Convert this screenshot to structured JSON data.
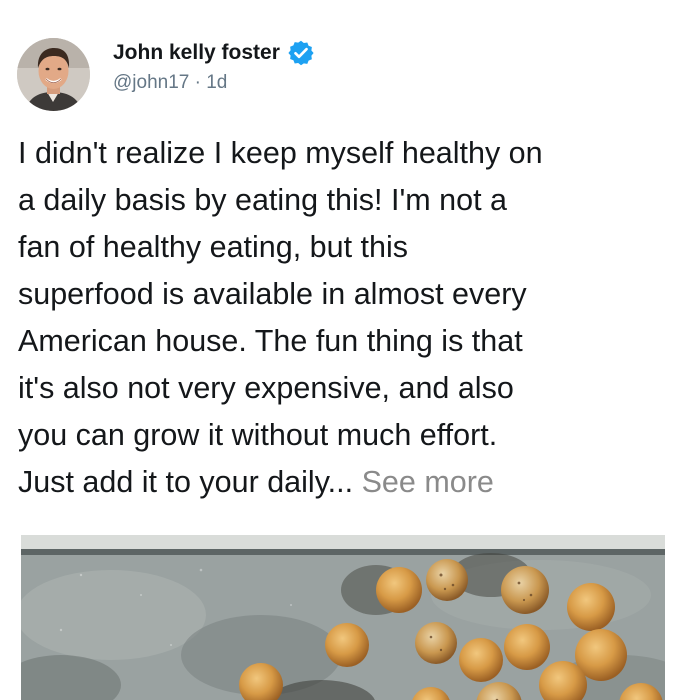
{
  "user": {
    "display_name": "John kelly foster",
    "handle": "@john17",
    "separator": "·",
    "timestamp": "1d",
    "verified": true,
    "verified_color": "#1da1f2"
  },
  "post": {
    "text": "I didn't realize I keep myself healthy on\na daily basis by eating this! I'm not a\nfan of healthy eating, but this\nsuperfood is available in almost every\nAmerican house. The fun thing is that\nit's also not very expensive, and also\nyou can grow it without much effort.\nJust add it to your daily...",
    "see_more": "See more"
  },
  "icons": {
    "avatar": "user-avatar-photo",
    "verified": "verified-badge-icon"
  },
  "colors": {
    "text": "#14171a",
    "secondary_text": "#657786",
    "see_more": "#8a8a8a"
  }
}
